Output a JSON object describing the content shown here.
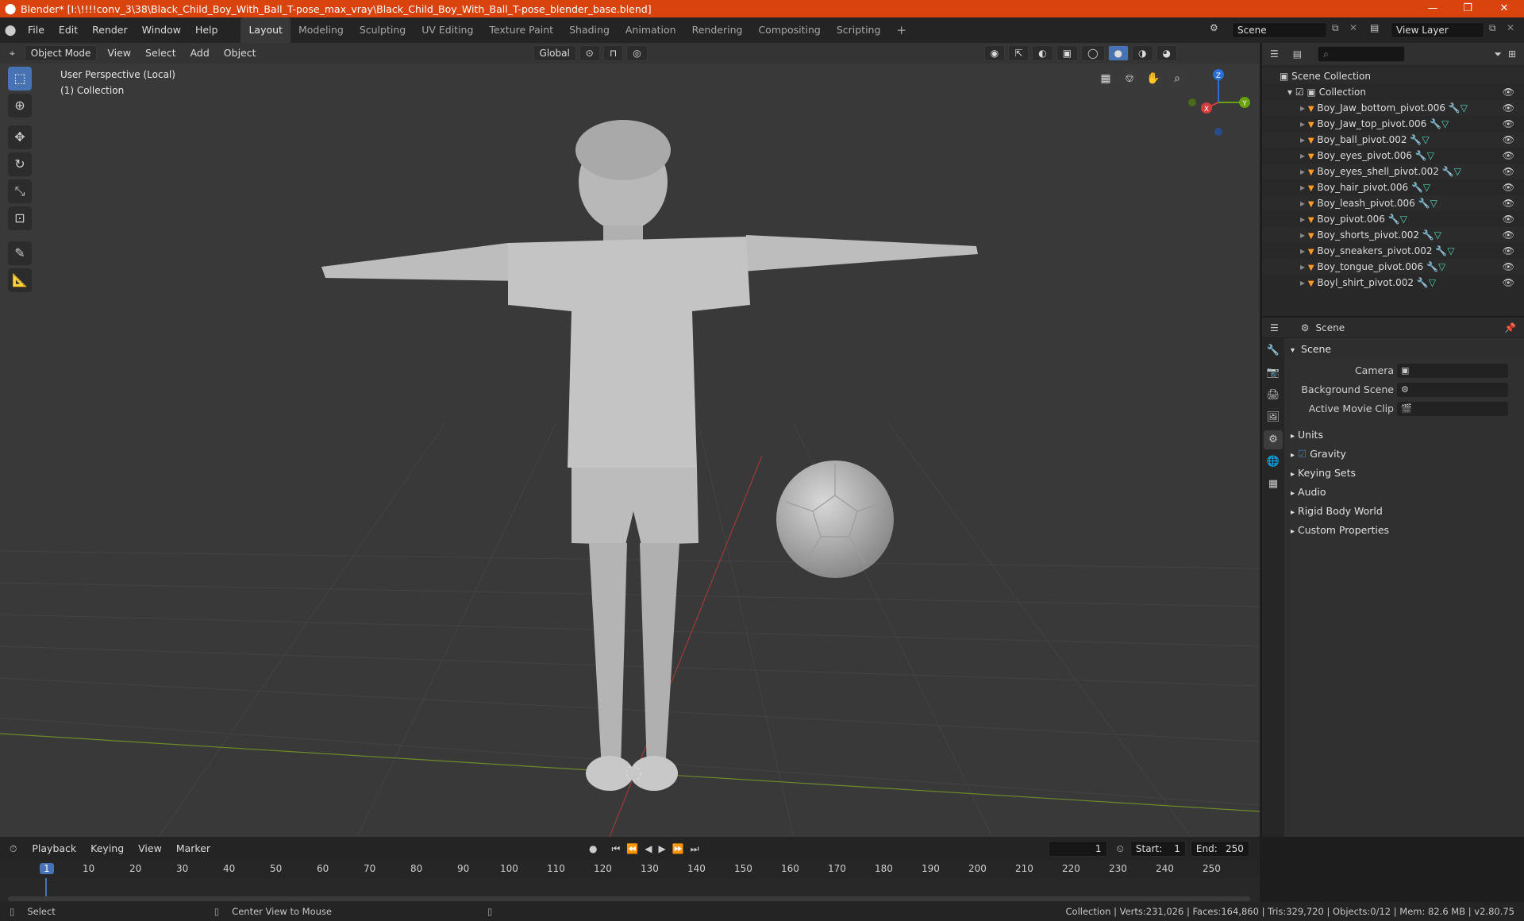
{
  "window": {
    "title": "Blender* [I:\\!!!!conv_3\\38\\Black_Child_Boy_With_Ball_T-pose_max_vray\\Black_Child_Boy_With_Ball_T-pose_blender_base.blend]",
    "minimize": "—",
    "maximize": "❐",
    "close": "✕"
  },
  "menu": [
    "File",
    "Edit",
    "Render",
    "Window",
    "Help"
  ],
  "workspaces": [
    "Layout",
    "Modeling",
    "Sculpting",
    "UV Editing",
    "Texture Paint",
    "Shading",
    "Animation",
    "Rendering",
    "Compositing",
    "Scripting"
  ],
  "active_workspace": "Layout",
  "add_workspace": "+",
  "scene_field": "Scene",
  "view_layer_field": "View Layer",
  "viewport": {
    "mode": "Object Mode",
    "menus": [
      "View",
      "Select",
      "Add",
      "Object"
    ],
    "orientation": "Global",
    "perspective_label": "User Perspective (Local)",
    "collection_label": "(1) Collection",
    "gizmo": {
      "x": "X",
      "y": "Y",
      "z": "Z"
    }
  },
  "outliner": {
    "root": "Scene Collection",
    "collection": "Collection",
    "items": [
      "Boy_Jaw_bottom_pivot.006",
      "Boy_Jaw_top_pivot.006",
      "Boy_ball_pivot.002",
      "Boy_eyes_pivot.006",
      "Boy_eyes_shell_pivot.002",
      "Boy_hair_pivot.006",
      "Boy_leash_pivot.006",
      "Boy_pivot.006",
      "Boy_shorts_pivot.002",
      "Boy_sneakers_pivot.002",
      "Boy_tongue_pivot.006",
      "Boyl_shirt_pivot.002"
    ]
  },
  "properties": {
    "header": "Scene",
    "panel_title": "Scene",
    "fields": {
      "camera": "Camera",
      "background_scene": "Background Scene",
      "active_movie_clip": "Active Movie Clip"
    },
    "panels": [
      "Units",
      "Gravity",
      "Keying Sets",
      "Audio",
      "Rigid Body World",
      "Custom Properties"
    ]
  },
  "timeline": {
    "menus": [
      "Playback",
      "Keying",
      "View",
      "Marker"
    ],
    "current_frame": "1",
    "start_label": "Start:",
    "start": "1",
    "end_label": "End:",
    "end": "250",
    "ticks": [
      "1",
      "10",
      "20",
      "30",
      "40",
      "50",
      "60",
      "70",
      "80",
      "90",
      "100",
      "110",
      "120",
      "130",
      "140",
      "150",
      "160",
      "170",
      "180",
      "190",
      "200",
      "210",
      "220",
      "230",
      "240",
      "250"
    ]
  },
  "status": {
    "left": "Select",
    "middle": "Center View to Mouse",
    "right": "Collection | Verts:231,026 | Faces:164,860 | Tris:329,720 | Objects:0/12 | Mem: 82.6 MB | v2.80.75"
  },
  "colors": {
    "titlebar": "#d8430e",
    "accent": "#4772b3",
    "viewport_bg": "#393939"
  }
}
